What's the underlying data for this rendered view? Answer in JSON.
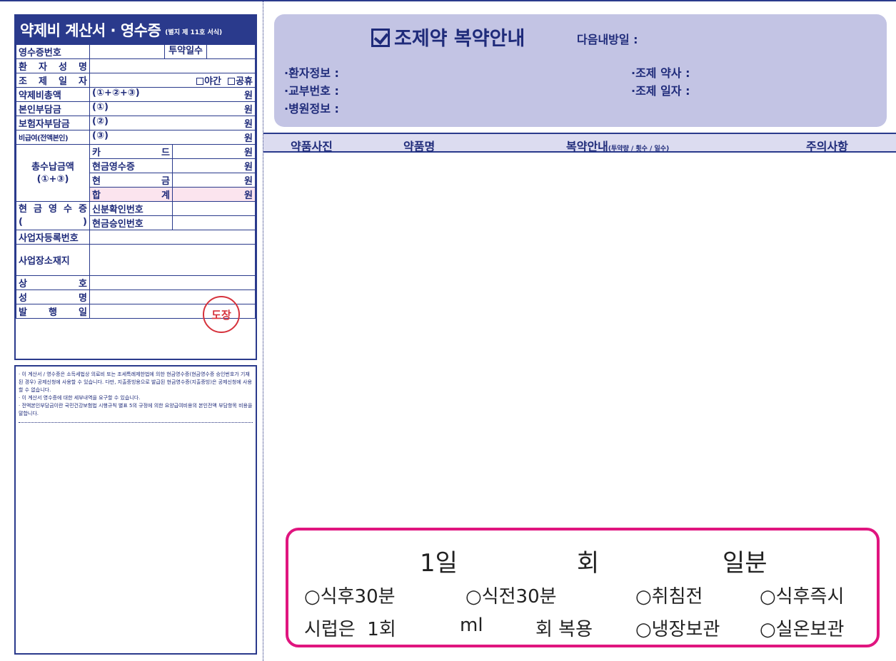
{
  "receipt": {
    "title": "약제비 계산서 · 영수증",
    "subtitle": "(별지 제 11호 서식)",
    "receipt_no": "영수증번호",
    "days_label": "투약일수",
    "patient_name": "환 자 성 명",
    "prep_date": "조 제 일 자",
    "night": "야간",
    "holiday": "공휴",
    "total_label": "약제비총액",
    "total_formula": "(①+②+③)",
    "self_label": "본인부담금",
    "self_formula": "(①)",
    "insurer_label": "보험자부담금",
    "insurer_formula": "(②)",
    "noncovered_label": "비급여(전액본인)",
    "noncovered_formula": "(③)",
    "won": "원",
    "paid_label": "총수납금액",
    "paid_formula": "(①+③)",
    "card": "카 드",
    "cash_receipt": "현금영수증",
    "cash": "현 금",
    "sum": "합 계",
    "cash_receipt_label": "현 금 영 수 증",
    "paren_left": "(",
    "paren_right": ")",
    "id_no": "신분확인번호",
    "approval_no": "현금승인번호",
    "biz_reg": "사업자등록번호",
    "biz_addr": "사업장소재지",
    "company": "상 호",
    "name": "성 명",
    "issue_date": "발 행 일",
    "stamp": "도장"
  },
  "notes": [
    "· 이 계산서 / 영수증은 소득세법상 의료비 또는 조세특례제한법에 의한 현금영수증(현금영수증 승인번호가 기재된 경우) 공제신청에 사용할 수 있습니다. 다만, 지출증빙용으로 발급된 현금영수증(지출증빙)은 공제신청에 사용할 수 없습니다.",
    "· 이 계산서 영수증에 대한 세부내역을 요구할 수 있습니다.",
    "· 전액본인부담금이란 국민건강보험법 시행규칙 별표 5의 규정에 의한 요양급여비용의 본인전액 부담항목 비용을 말합니다."
  ],
  "guide": {
    "title": "조제약 복약안내",
    "next_visit": "다음내방일 :",
    "patient_info": "·환자정보 :",
    "issue_no": "·교부번호 :",
    "hospital_info": "·병원정보 :",
    "pharmacist": "·조제 약사 :",
    "prep_date": "·조제 일자 :"
  },
  "columns": {
    "photo": "약품사진",
    "drug_name": "약품명",
    "instructions": "복약안내",
    "instructions_sub": "(투약량 / 횟수 / 일수)",
    "cautions": "주의사항"
  },
  "dosage": {
    "day": "1일",
    "times": "회",
    "days": "일분",
    "after_meal_30": "○식후30분",
    "before_meal_30": "○식전30분",
    "bedtime": "○취침전",
    "right_after_meal": "○식후즉시",
    "syrup": "시럽은  1회",
    "ml": "ml",
    "times_take": "회 복용",
    "fridge": "○냉장보관",
    "room_temp": "○실온보관"
  }
}
